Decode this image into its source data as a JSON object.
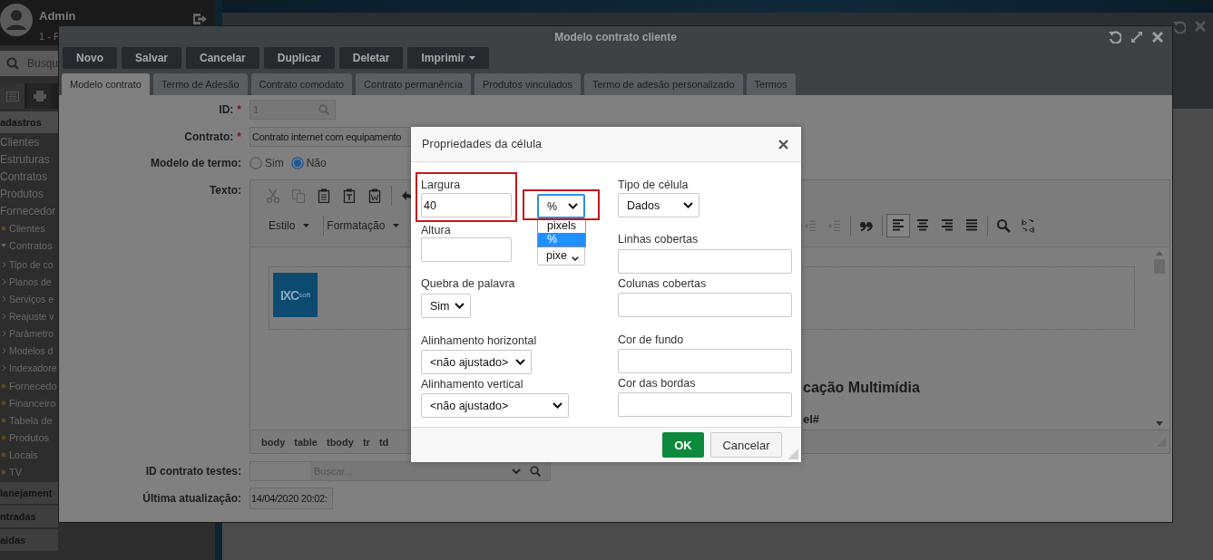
{
  "sidebar": {
    "user": {
      "name": "Admin",
      "detail": "1 - F"
    },
    "search": {
      "placeholder": "Busqu"
    },
    "tabs": [
      {
        "kind": "list",
        "selected": true
      },
      {
        "kind": "printer",
        "selected": false
      }
    ],
    "menu": [
      {
        "kind": "section",
        "label": "adastros",
        "expanded": true
      },
      {
        "kind": "link",
        "label": "Clientes"
      },
      {
        "kind": "link",
        "label": "Estruturas"
      },
      {
        "kind": "link",
        "label": "Contratos"
      },
      {
        "kind": "link",
        "label": "Produtos"
      },
      {
        "kind": "link",
        "label": "Fornecedor"
      },
      {
        "kind": "folder",
        "label": "Clientes",
        "expanded": false
      },
      {
        "kind": "folder",
        "label": "Contratos",
        "expanded": true,
        "children": [
          {
            "label": "Tipo de co"
          },
          {
            "label": "Planos de"
          },
          {
            "label": "Serviços e"
          },
          {
            "label": "Reajuste v"
          },
          {
            "label": "Parâmetro"
          },
          {
            "label": "Modelos d"
          },
          {
            "label": "Indexadore"
          }
        ]
      },
      {
        "kind": "folder",
        "label": "Fornecedo",
        "expanded": false
      },
      {
        "kind": "folder",
        "label": "Financeiro",
        "expanded": false
      },
      {
        "kind": "folder",
        "label": "Tabela de",
        "expanded": false
      },
      {
        "kind": "folder",
        "label": "Produtos",
        "expanded": false
      },
      {
        "kind": "folder",
        "label": "Locais",
        "expanded": false
      },
      {
        "kind": "folder",
        "label": "TV",
        "expanded": false
      },
      {
        "kind": "section",
        "label": "lanejament",
        "expanded": false
      },
      {
        "kind": "section",
        "label": "ntradas",
        "expanded": false
      },
      {
        "kind": "section",
        "label": "aidas",
        "expanded": false
      }
    ]
  },
  "modal": {
    "title": "Modelo contrato cliente",
    "buttons": [
      {
        "label": "Novo"
      },
      {
        "label": "Salvar"
      },
      {
        "label": "Cancelar"
      },
      {
        "label": "Duplicar"
      },
      {
        "label": "Deletar"
      },
      {
        "label": "Imprimir",
        "dropdown": true
      }
    ],
    "tabs": [
      {
        "label": "Modelo contrato",
        "selected": true
      },
      {
        "label": "Termo de Adesão",
        "selected": false
      },
      {
        "label": "Contrato comodato",
        "selected": false
      },
      {
        "label": "Contrato permanência",
        "selected": false
      },
      {
        "label": "Produtos vinculados",
        "selected": false
      },
      {
        "label": "Termo de adesão personalizado",
        "selected": false
      },
      {
        "label": "Termos",
        "selected": false
      }
    ],
    "form": {
      "id": {
        "label": "ID:",
        "mark": "*",
        "value": "1"
      },
      "contract": {
        "label": "Contrato:",
        "mark": "*",
        "value": "Contrato internet com equipamento"
      },
      "term_model": {
        "label": "Modelo de termo:",
        "options": [
          {
            "label": "Sim",
            "selected": false
          },
          {
            "label": "Não",
            "selected": true
          }
        ]
      },
      "text": {
        "label": "Texto:"
      },
      "test_contract": {
        "label": "ID contrato testes:",
        "placeholder": "Buscar..."
      },
      "last_update": {
        "label": "Última atualização:",
        "value": "14/04/2020 20:02:"
      }
    },
    "editor": {
      "menus": [
        {
          "label": "Estilo"
        },
        {
          "label": "Formatação"
        }
      ],
      "alignment": [
        {
          "kind": "left",
          "selected": true
        },
        {
          "kind": "center",
          "selected": false
        },
        {
          "kind": "right",
          "selected": false
        },
        {
          "kind": "justify",
          "selected": false
        }
      ],
      "logo": {
        "text": "IXC",
        "sub": "soft"
      },
      "heading": "cação Multimídia",
      "line": "el#",
      "path": [
        "body",
        "table",
        "tbody",
        "tr",
        "td"
      ]
    }
  },
  "dialog": {
    "title": "Propriedades da célula",
    "width": {
      "label": "Largura",
      "value": "40",
      "highlighted": true
    },
    "width_unit": {
      "value": "%",
      "highlighted": true,
      "open": true,
      "options": [
        {
          "label": "pixels",
          "selected": false
        },
        {
          "label": "%",
          "selected": true
        }
      ]
    },
    "height": {
      "label": "Altura"
    },
    "height_unit": {
      "value": "pixe"
    },
    "word_wrap": {
      "label": "Quebra de palavra",
      "value": "Sim"
    },
    "h_align": {
      "label": "Alinhamento horizontal",
      "value": "<não ajustado>"
    },
    "v_align": {
      "label": "Alinhamento vertical",
      "value": "<não ajustado>"
    },
    "cell_type": {
      "label": "Tipo de célula",
      "value": "Dados"
    },
    "rows_spanned": {
      "label": "Linhas cobertas"
    },
    "cols_spanned": {
      "label": "Colunas cobertas"
    },
    "background": {
      "label": "Cor de fundo"
    },
    "border_color": {
      "label": "Cor das bordas"
    },
    "buttons": [
      {
        "label": "OK",
        "kind": "primary"
      },
      {
        "label": "Cancelar",
        "kind": "secondary"
      }
    ]
  }
}
